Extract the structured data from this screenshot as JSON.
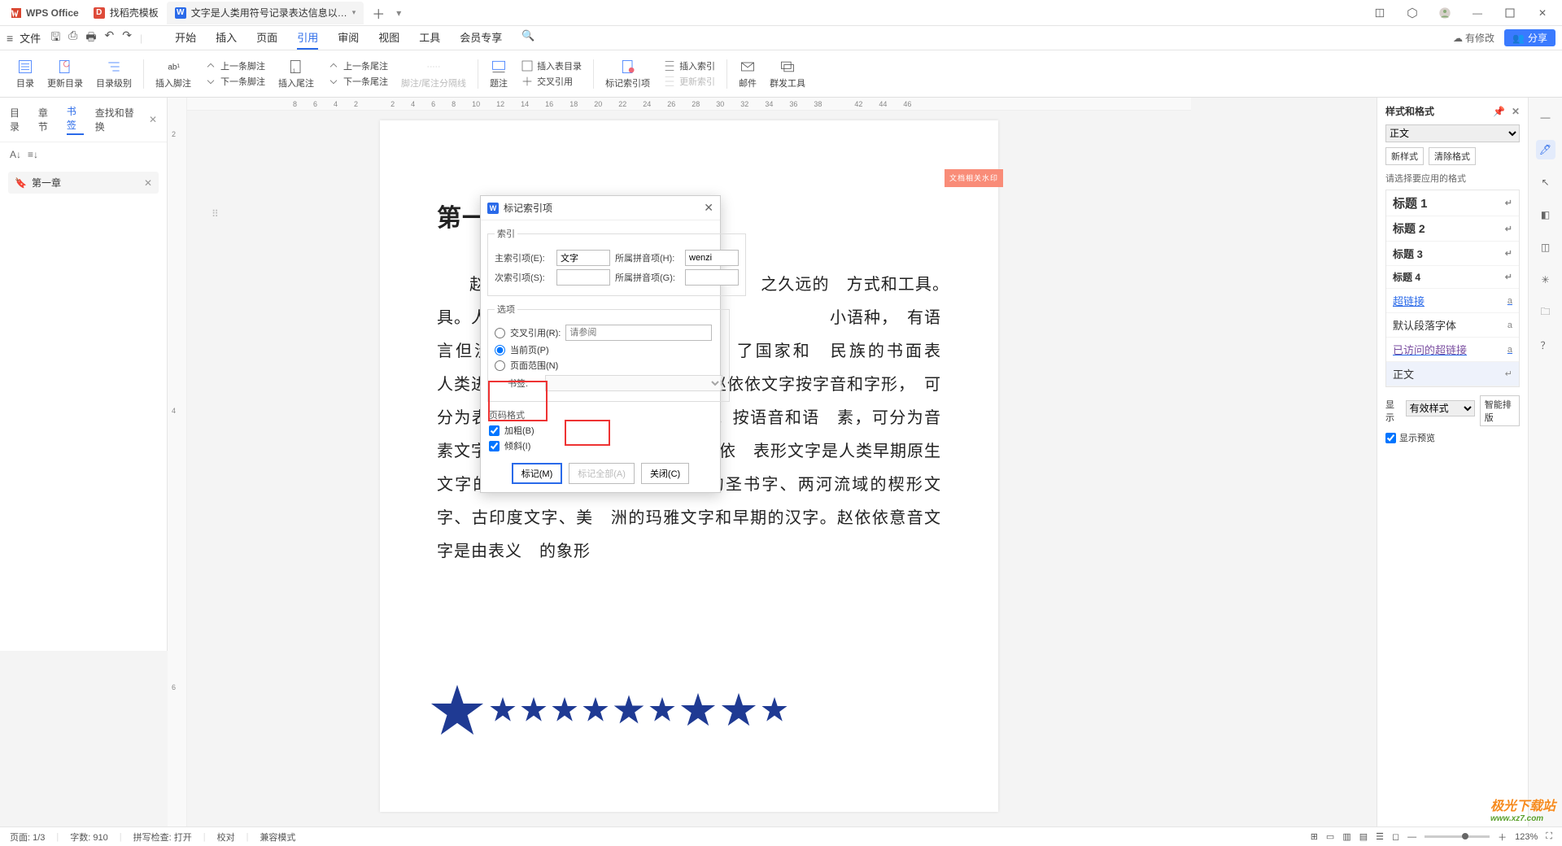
{
  "app": {
    "name": "WPS Office"
  },
  "tabs": {
    "t1": "找稻壳模板",
    "t2": "文字是人类用符号记录表达信息以…"
  },
  "menu": {
    "file": "文件",
    "items": [
      "开始",
      "插入",
      "页面",
      "引用",
      "审阅",
      "视图",
      "工具",
      "会员专享"
    ]
  },
  "topbar_right": {
    "modified": "有修改",
    "share": "分享"
  },
  "ribbon": {
    "toc": "目录",
    "update_toc": "更新目录",
    "toc_level": "目录级别",
    "ins_footnote": "插入脚注",
    "prev_footnote": "上一条脚注",
    "next_footnote": "下一条脚注",
    "ins_endnote": "插入尾注",
    "prev_endnote": "上一条尾注",
    "next_endnote": "下一条尾注",
    "sep": "脚注/尾注分隔线",
    "caption": "题注",
    "ins_figtoc": "插入表目录",
    "crossref": "交叉引用",
    "mark_idx": "标记索引项",
    "ins_index": "插入索引",
    "upd_index": "更新索引",
    "mail": "邮件",
    "mass": "群发工具"
  },
  "leftnav": {
    "tabs": [
      "目录",
      "章节",
      "书签",
      "查找和替换"
    ],
    "bookmark": "第一章"
  },
  "ruler_h": [
    "8",
    "6",
    "4",
    "2",
    "",
    "2",
    "4",
    "6",
    "8",
    "10",
    "12",
    "14",
    "16",
    "18",
    "20",
    "22",
    "24",
    "26",
    "28",
    "30",
    "32",
    "34",
    "36",
    "38",
    "",
    "42",
    "44",
    "46"
  ],
  "ruler_v": [
    "2",
    "4",
    "6"
  ],
  "document": {
    "title": "第一章",
    "watermark": "文档相关水印",
    "body": "赵依依是　　　　　　　　　　　　　之久远的　方式和工具。　　　　　　　　　　　　具。人类　往往先有口头　　　　　　　　　　　　小语种，　有语言但没有　　　　　　　　　　　　了国家和　民族的书面表　　　　　　　　　　　　人类进入　有历史记录的文明社会。赵依依文字按字音和字形，　可分为表形文字、表音文字和意音文字。按语音和语　素，可分为音素文字、音节文字和语素文字。　赵依依　表形文字是人类早期原生文字的象形文字，比如：古埃　及的圣书字、两河流域的楔形文字、古印度文字、美　洲的玛雅文字和早期的汉字。赵依依意音文字是由表义　的象形"
  },
  "dialog": {
    "title": "标记索引项",
    "grp_index": "索引",
    "main_label": "主索引项(E):",
    "main_value": "文字",
    "pinyin1_label": "所属拼音项(H):",
    "pinyin1_value": "wenzi",
    "sub_label": "次索引项(S):",
    "sub_value": "",
    "pinyin2_label": "所属拼音项(G):",
    "pinyin2_value": "",
    "grp_options": "选项",
    "opt_cross": "交叉引用(R):",
    "opt_cross_ph": "请参阅",
    "opt_current": "当前页(P)",
    "opt_range": "页面范围(N)",
    "bookmark_lbl": "书签:",
    "grp_format": "页码格式",
    "chk_bold": "加粗(B)",
    "chk_italic": "倾斜(I)",
    "btn_mark": "标记(M)",
    "btn_mark_all": "标记全部(A)",
    "btn_close": "关闭(C)"
  },
  "stylepanel": {
    "title": "样式和格式",
    "current": "正文",
    "newstyle": "新样式",
    "clear": "清除格式",
    "hint": "请选择要应用的格式",
    "styles": {
      "h1": "标题 1",
      "h2": "标题 2",
      "h3": "标题 3",
      "h4": "标题 4",
      "link": "超链接",
      "default_para": "默认段落字体",
      "visited": "已访问的超链接",
      "body": "正文"
    },
    "show_lbl": "显示",
    "show_val": "有效样式",
    "preview": "显示预览"
  },
  "smartlayout": "智能排版",
  "statusbar": {
    "page": "页面: 1/3",
    "words": "字数: 910",
    "spell": "拼写检查: 打开",
    "proof": "校对",
    "compat": "兼容模式",
    "zoom": "123%"
  },
  "watermark_site": "极光下载站",
  "watermark_url": "www.xz7.com"
}
